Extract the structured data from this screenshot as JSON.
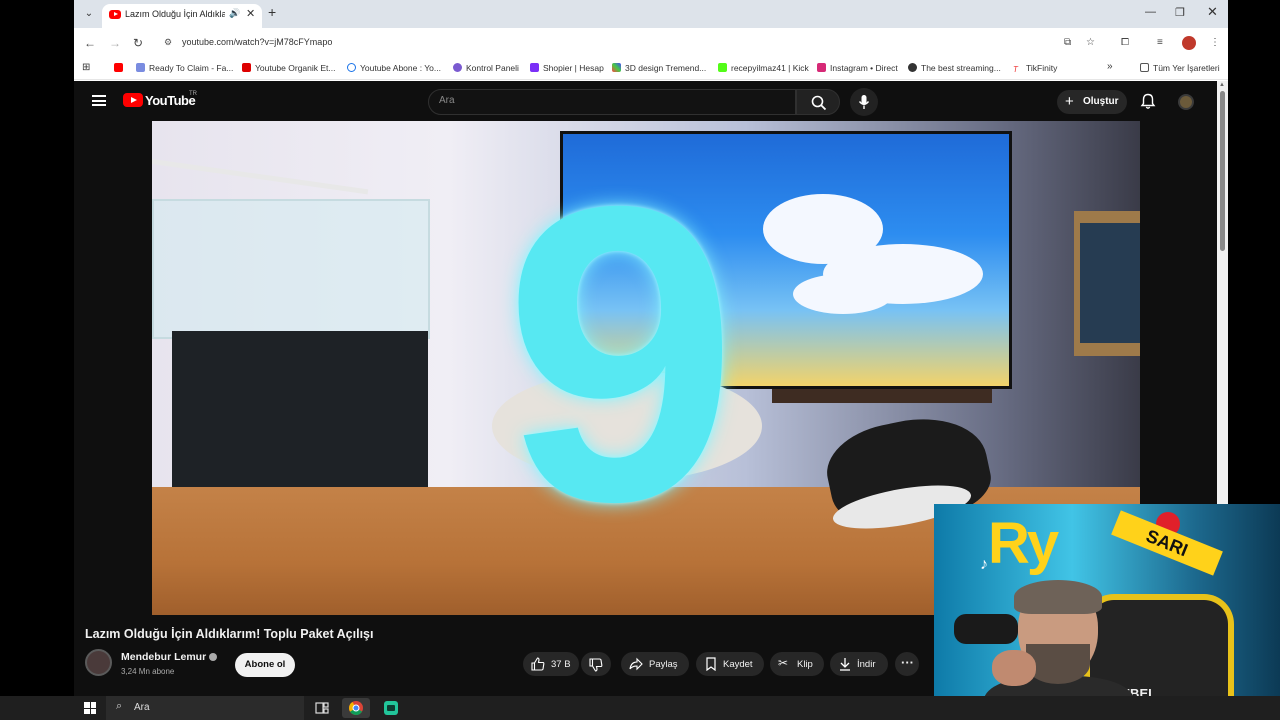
{
  "browser": {
    "tab_title": "Lazım Olduğu İçin Aldıklarım!",
    "url": "youtube.com/watch?v=jM78cFYmapo",
    "bookmarks": [
      "Ready To Claim - Fa...",
      "Youtube Organik Et...",
      "Youtube Abone : Yo...",
      "Kontrol Paneli",
      "Shopier | Hesap",
      "3D design Tremend...",
      "recepyilmaz41 | Kick",
      "Instagram • Direct",
      "The best streaming...",
      "TikFinity"
    ],
    "all_bookmarks": "Tüm Yer İşaretleri"
  },
  "youtube": {
    "logo_text": "YouTube",
    "country_code": "TR",
    "search_placeholder": "Ara",
    "create_label": "Oluştur"
  },
  "video": {
    "countdown_number": "9",
    "title": "Lazım Olduğu İçin Aldıklarım! Toplu Paket Açılışı",
    "channel_name": "Mendebur Lemur",
    "subscribers": "3,24 Mn abone",
    "subscribe_label": "Abone ol",
    "like_count": "37 B",
    "share_label": "Paylaş",
    "save_label": "Kaydet",
    "clip_label": "Klip",
    "download_label": "İndir"
  },
  "webcam": {
    "logo_text": "Ry",
    "badge_text": "SARI",
    "chair_text": "REBEL"
  },
  "taskbar": {
    "search_placeholder": "Ara"
  }
}
